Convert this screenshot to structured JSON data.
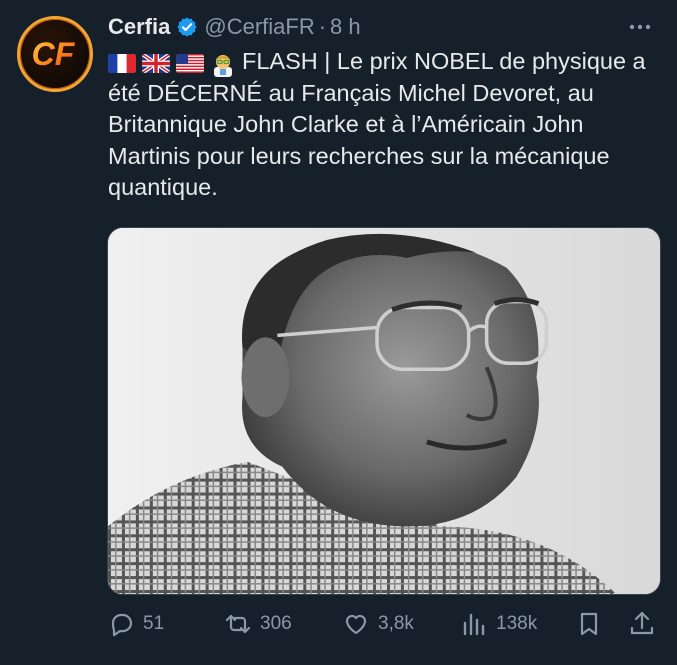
{
  "author": {
    "name": "Cerfia",
    "handle": "@CerfiaFR",
    "separator": "·",
    "time": "8 h",
    "avatar_text": "CF",
    "verified_color": "#1d9bf0"
  },
  "tweet": {
    "emojis": [
      "flag-france",
      "flag-united-kingdom",
      "flag-united-states",
      "scientist-emoji"
    ],
    "text": "FLASH | Le prix NOBEL de physique a été DÉCERNÉ au Français Michel Devoret, au Britannique John Clarke et à l’Américain John Martinis pour leurs recherches sur la mécanique quantique."
  },
  "media": {
    "icon": "portrait-photo",
    "style": "black-and-white"
  },
  "actions": {
    "replies": "51",
    "reposts": "306",
    "likes": "3,8k",
    "views": "138k"
  },
  "colors": {
    "background": "#15202b",
    "text": "#e7e9ea",
    "muted": "#8b98a5",
    "accent_orange": "#f2a531"
  }
}
